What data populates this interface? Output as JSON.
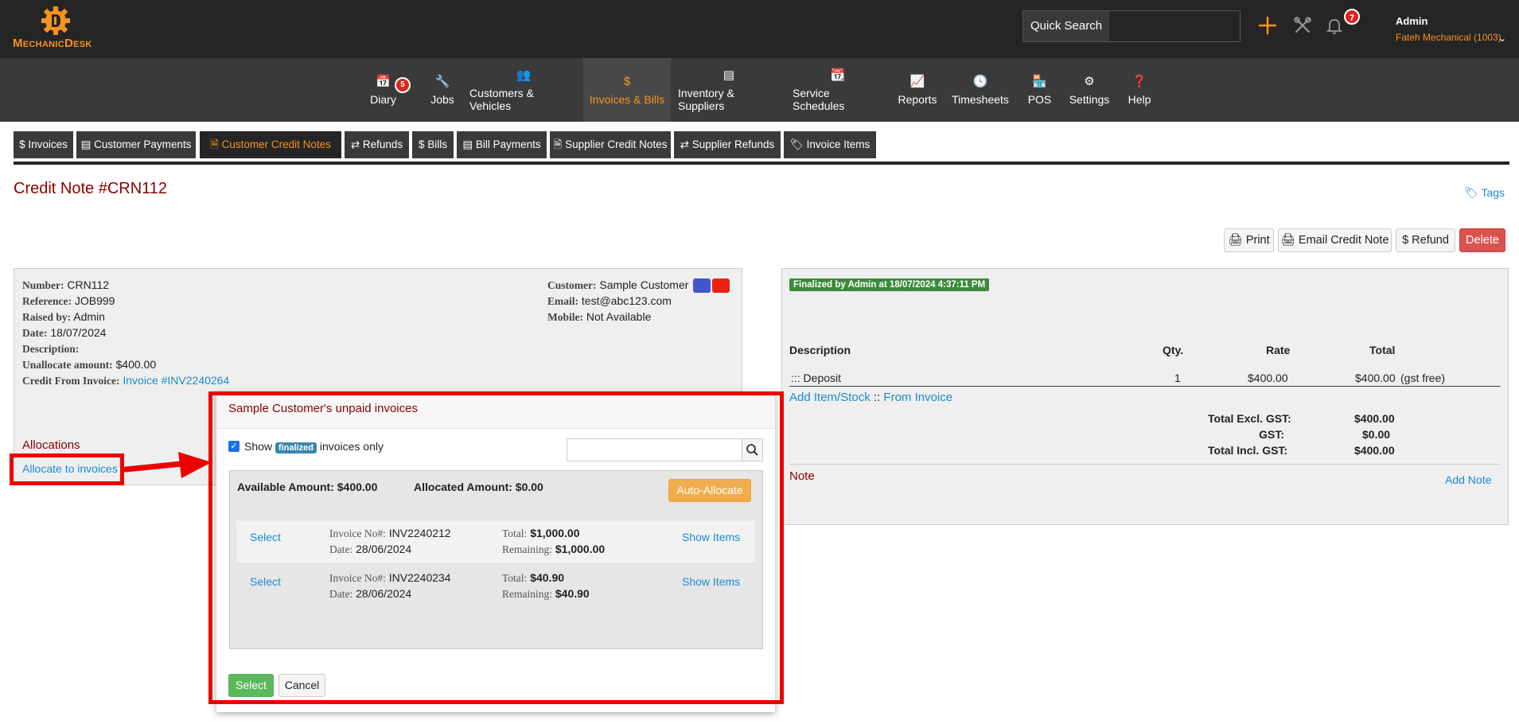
{
  "brand": {
    "name": "MechanicDesk",
    "accent": "#f7941e"
  },
  "topbar": {
    "quick_search_label": "Quick Search",
    "notifications_count": "7",
    "user_name": "Admin",
    "user_org": "Fateh Mechanical (1003)"
  },
  "nav": {
    "items": [
      {
        "label": "Diary",
        "icon": "calendar-icon",
        "badge": "5"
      },
      {
        "label": "Jobs",
        "icon": "wrench-icon"
      },
      {
        "label": "Customers & Vehicles",
        "icon": "users-icon"
      },
      {
        "label": "Invoices & Bills",
        "icon": "dollar-icon",
        "active": true
      },
      {
        "label": "Inventory & Suppliers",
        "icon": "inventory-icon"
      },
      {
        "label": "Service Schedules",
        "icon": "calendar-check-icon"
      },
      {
        "label": "Reports",
        "icon": "chart-icon"
      },
      {
        "label": "Timesheets",
        "icon": "clock-icon"
      },
      {
        "label": "POS",
        "icon": "store-icon"
      },
      {
        "label": "Settings",
        "icon": "gear-icon"
      },
      {
        "label": "Help",
        "icon": "question-icon"
      }
    ]
  },
  "subtabs": [
    {
      "label": "$ Invoices"
    },
    {
      "label": "Customer Payments"
    },
    {
      "label": "Customer Credit Notes",
      "active": true
    },
    {
      "label": "⇄ Refunds"
    },
    {
      "label": "$ Bills"
    },
    {
      "label": "Bill Payments"
    },
    {
      "label": "Supplier Credit Notes"
    },
    {
      "label": "⇄ Supplier Refunds"
    },
    {
      "label": "Invoice Items"
    }
  ],
  "page": {
    "title": "Credit Note #CRN112",
    "tags": "Tags"
  },
  "actions": {
    "print": "Print",
    "email": "Email Credit Note",
    "refund": "$ Refund",
    "delete": "Delete"
  },
  "details": {
    "number_k": "Number:",
    "number": "CRN112",
    "reference_k": "Reference:",
    "reference": "JOB999",
    "raised_k": "Raised by:",
    "raised": "Admin",
    "date_k": "Date:",
    "date": "18/07/2024",
    "description_k": "Description:",
    "unallocate_k": "Unallocate amount:",
    "unallocate": "$400.00",
    "credit_from_k": "Credit From Invoice:",
    "credit_from": "Invoice #INV2240264",
    "customer_k": "Customer:",
    "customer": "Sample Customer",
    "email_k": "Email:",
    "email": "test@abc123.com",
    "mobile_k": "Mobile:",
    "mobile": "Not Available",
    "swatch_colors": [
      "#4455cc",
      "#ee2211"
    ]
  },
  "allocations": {
    "title": "Allocations",
    "link": "Allocate to invoices"
  },
  "right": {
    "finalized": "Finalized by Admin at 18/07/2024 4:37:11 PM",
    "headers": {
      "description": "Description",
      "qty": "Qty.",
      "rate": "Rate",
      "total": "Total"
    },
    "line": {
      "description": "::: Deposit",
      "qty": "1",
      "rate": "$400.00",
      "total": "$400.00",
      "tax": "(gst free)"
    },
    "add_item": "Add Item/Stock",
    "sep": "::",
    "from_invoice": "From Invoice",
    "totals": [
      {
        "label": "Total Excl. GST:",
        "value": "$400.00"
      },
      {
        "label": "GST:",
        "value": "$0.00"
      },
      {
        "label": "Total Incl. GST:",
        "value": "$400.00"
      }
    ],
    "note": "Note",
    "add_note": "Add Note"
  },
  "modal": {
    "title": "Sample Customer's unpaid invoices",
    "show": "Show",
    "finalized": "finalized",
    "invoices_only": "invoices only",
    "available": "Available Amount: $400.00",
    "allocated": "Allocated Amount: $0.00",
    "auto_allocate": "Auto-Allocate",
    "invoices": [
      {
        "select": "Select",
        "no_k": "Invoice No#:",
        "no": "INV2240212",
        "date_k": "Date:",
        "date": "28/06/2024",
        "total_k": "Total:",
        "total": "$1,000.00",
        "remaining_k": "Remaining:",
        "remaining": "$1,000.00",
        "show_items": "Show Items"
      },
      {
        "select": "Select",
        "no_k": "Invoice No#:",
        "no": "INV2240234",
        "date_k": "Date:",
        "date": "28/06/2024",
        "total_k": "Total:",
        "total": "$40.90",
        "remaining_k": "Remaining:",
        "remaining": "$40.90",
        "show_items": "Show Items"
      }
    ],
    "select_btn": "Select",
    "cancel_btn": "Cancel"
  }
}
